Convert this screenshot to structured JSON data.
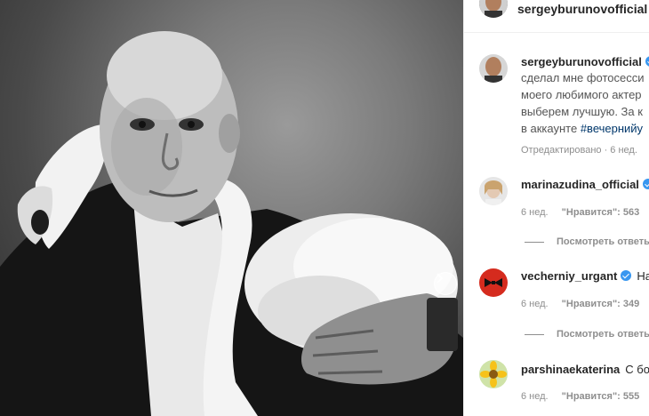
{
  "post": {
    "author": "sergeyburunovofficial",
    "caption_lines": [
      "сделал мне фотосесси",
      "моего любимого актер",
      "выберем лучшую. За к",
      "в аккаунте "
    ],
    "hashtag": "#вечернийу",
    "edited": "Отредактировано · 6 нед."
  },
  "comments": [
    {
      "user": "marinazudina_official",
      "text": "",
      "age": "6 нед.",
      "likes": "\"Нравится\": 563",
      "reply": "Посмотреть ответь"
    },
    {
      "user": "vecherniy_urgant",
      "text": "Нам",
      "age": "6 нед.",
      "likes": "\"Нравится\": 349",
      "reply": "Посмотреть ответь"
    },
    {
      "user": "parshinaekaterina",
      "text": "С бок",
      "age": "6 нед.",
      "likes": "\"Нравится\": 555",
      "reply": ""
    }
  ],
  "colors": {
    "verified": "#3897f0",
    "hashtag": "#00376b",
    "muted": "#8e8e8e"
  },
  "icons": [
    "verified-icon",
    "chevron-right-icon"
  ]
}
